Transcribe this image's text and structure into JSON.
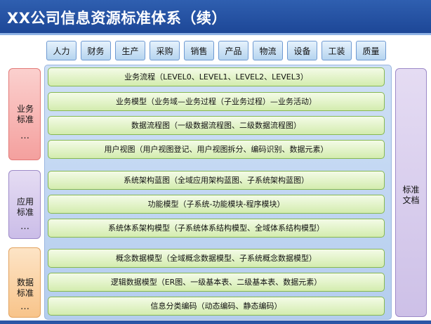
{
  "title": "XX公司信息资源标准体系（续）",
  "top_categories": [
    "人力",
    "财务",
    "生产",
    "采购",
    "销售",
    "产品",
    "物流",
    "设备",
    "工装",
    "质量"
  ],
  "side_groups": [
    {
      "line1": "业务",
      "line2": "标准",
      "dots": "…"
    },
    {
      "line1": "应用",
      "line2": "标准",
      "dots": "…"
    },
    {
      "line1": "数据",
      "line2": "标准",
      "dots": "…"
    }
  ],
  "rows": [
    "业务流程（LEVEL0、LEVEL1、LEVEL2、LEVEL3）",
    "业务模型（业务域—业务过程（子业务过程）—业务活动）",
    "数据流程图（一级数据流程图、二级数据流程图）",
    "用户视图（用户视图登记、用户视图拆分、编码识别、数据元素）",
    "系统架构蓝图（全域应用架构蓝图、子系统架构蓝图）",
    "功能模型（子系统-功能模块-程序模块）",
    "系统体系架构模型（子系统体系结构模型、全域体系结构模型）",
    "概念数据模型（全域概念数据模型、子系统概念数据模型）",
    "逻辑数据模型（ER图、一级基本表、二级基本表、数据元素）",
    "信息分类编码（动态编码、静态编码）"
  ],
  "right_label": {
    "line1": "标准",
    "line2": "文档"
  },
  "colors": {
    "header": "#1d4797",
    "panel": "#b4cdee",
    "row": "#d3ecae",
    "business": "#f4a09e",
    "application": "#cbbde8",
    "data": "#f8c48a"
  }
}
